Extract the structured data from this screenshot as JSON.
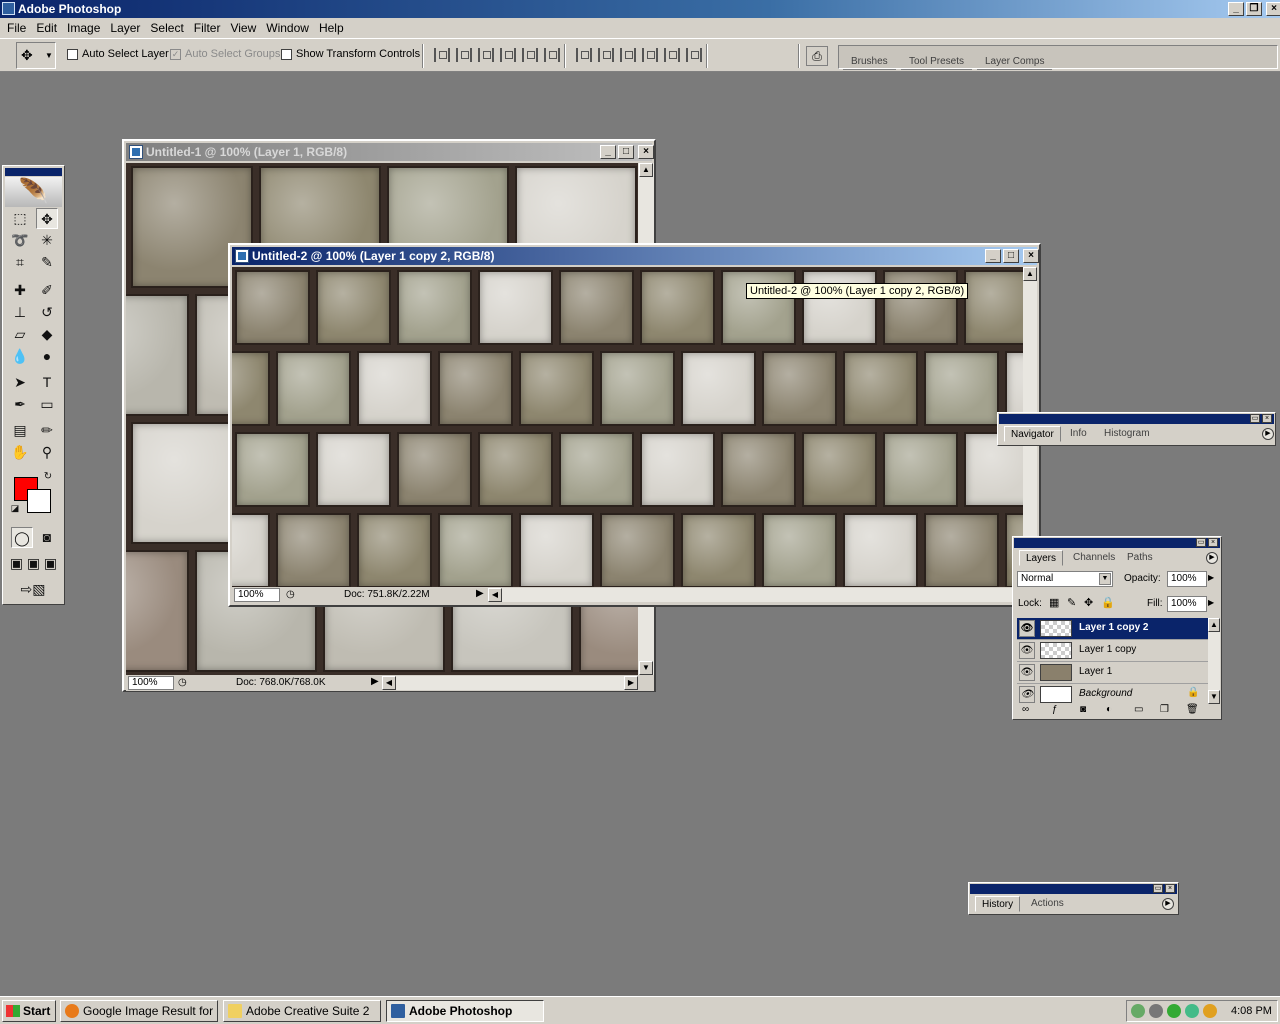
{
  "app": {
    "title": "Adobe Photoshop"
  },
  "menu": [
    "File",
    "Edit",
    "Image",
    "Layer",
    "Select",
    "Filter",
    "View",
    "Window",
    "Help"
  ],
  "options": {
    "auto_select_layer": "Auto Select Layer",
    "auto_select_groups": "Auto Select Groups",
    "show_transform_controls": "Show Transform Controls",
    "well_tabs": [
      "Brushes",
      "Tool Presets",
      "Layer Comps"
    ]
  },
  "doc1": {
    "title": "Untitled-1 @ 100% (Layer 1, RGB/8)",
    "zoom": "100%",
    "doc_info": "Doc: 768.0K/768.0K"
  },
  "doc2": {
    "title": "Untitled-2 @ 100% (Layer 1 copy 2, RGB/8)",
    "zoom": "100%",
    "doc_info": "Doc: 751.8K/2.22M"
  },
  "tooltip": "Untitled-2 @ 100% (Layer 1 copy 2, RGB/8)",
  "navigator": {
    "tabs": [
      "Navigator",
      "Info",
      "Histogram"
    ]
  },
  "layers": {
    "tabs": [
      "Layers",
      "Channels",
      "Paths"
    ],
    "blend_mode": "Normal",
    "opacity_label": "Opacity:",
    "opacity": "100%",
    "lock_label": "Lock:",
    "fill_label": "Fill:",
    "fill": "100%",
    "items": [
      "Layer 1 copy 2",
      "Layer 1 copy",
      "Layer 1",
      "Background"
    ]
  },
  "history": {
    "tabs": [
      "History",
      "Actions"
    ]
  },
  "taskbar": {
    "start": "Start",
    "tasks": [
      "Google Image Result for ...",
      "Adobe Creative Suite 2",
      "Adobe Photoshop"
    ],
    "clock": "4:08 PM"
  },
  "colors": {
    "foreground": "#ff0000",
    "background": "#ffffff",
    "title_active": "#0a246a"
  }
}
